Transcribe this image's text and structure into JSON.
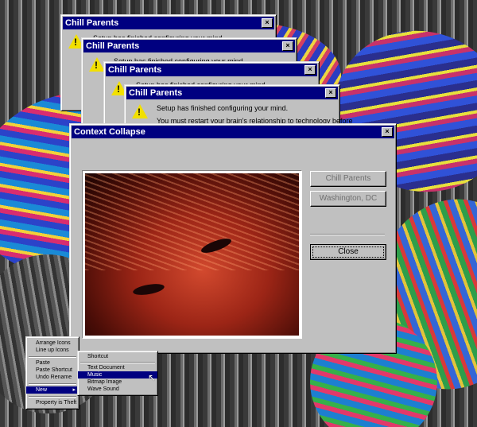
{
  "setup_dialogs": {
    "title": "Chill Parents",
    "message1": "Setup has finished configuring your mind.",
    "message2": "You must restart your brain's relationship to technology before",
    "close_glyph": "×"
  },
  "main_dialog": {
    "title": "Context Collapse",
    "close_glyph": "×",
    "buttons": {
      "chill_parents": "Chill Parents",
      "washington": "Washington, DC",
      "close": "Close"
    }
  },
  "context_menu": {
    "items": [
      "Arrange Icons",
      "Line up Icons",
      "Paste",
      "Paste Shortcut",
      "Undo Rename",
      "New",
      "Property is Theft"
    ],
    "new_arrow": "▸",
    "submenu": [
      "Shortcut",
      "Text Document",
      "Music",
      "Bitmap Image",
      "Wave Sound"
    ],
    "selected_submenu_index": 2
  },
  "icons": {
    "warning": "warning-icon",
    "cursor": "mouse-pointer-icon"
  },
  "colors": {
    "titlebar": "#000080",
    "face": "#c0c0c0",
    "warning": "#f2e000"
  }
}
